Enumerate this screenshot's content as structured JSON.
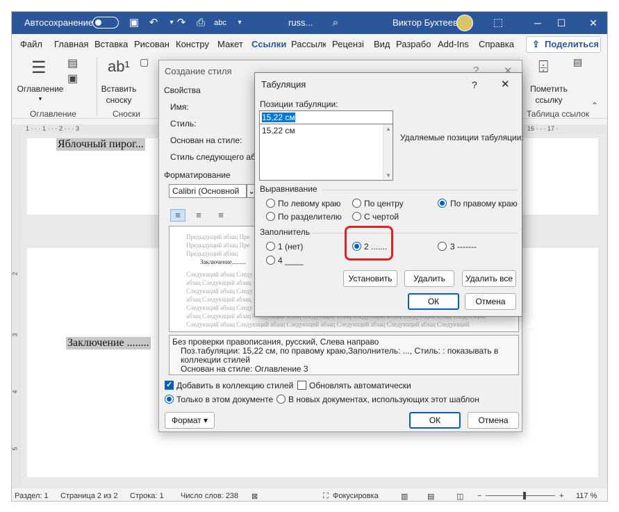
{
  "titlebar": {
    "autosave": "Автосохранение",
    "doc_name": "russ...",
    "user_name": "Виктор Бухтеев"
  },
  "menu": {
    "tabs": [
      "Файл",
      "Главная",
      "Вставка",
      "Рисован",
      "Констру",
      "Макет",
      "Ссылки",
      "Рассылк",
      "Рецензі",
      "Вид",
      "Разрабо",
      "Add-Ins",
      "Справка"
    ],
    "active_tab": "Ссылки",
    "share": "Поделиться"
  },
  "ribbon": {
    "toc_label": "Оглавление",
    "toc_group": "Оглавление",
    "footnote_label_1": "Вставить",
    "footnote_label_2": "сноску",
    "footnote_group": "Сноски",
    "mark_label_1": "Пометить",
    "mark_label_2": "ссылку",
    "tables_group": "Таблица ссылок"
  },
  "ruler": {
    "left": "1 · · · 1 · · · 2 · · · 3",
    "right": "16 · · · 17 ·",
    "v2": "2",
    "v3": "3",
    "v4": "4",
    "v5": "5"
  },
  "document": {
    "line1": "Яблочный пирог...",
    "line2": "Заключение ........"
  },
  "statusbar": {
    "section": "Раздел: 1",
    "page": "Страница 2 из 2",
    "line": "Строка: 1",
    "words": "Число слов: 238",
    "focus": "Фокусировка",
    "zoom": "117 %"
  },
  "style_dialog": {
    "title": "Создание стиля",
    "properties": "Свойства",
    "name_label": "Имя:",
    "style_label": "Стиль:",
    "based_on_label": "Основан на стиле:",
    "next_style_label": "Стиль следующего абза",
    "formatting": "Форматирование",
    "font": "Calibri (Основной",
    "preview": {
      "prev1": "Предыдущий абзац Пре",
      "prev2": "Предыдущий абзац Пре",
      "prev3": "Предыдущий абзац",
      "sample": "Заключение.........",
      "next_lines": [
        "Следующий абзац Следу",
        "абзац Следующий абзац",
        "Следующий абзац Следу",
        "абзац Следующий абзац",
        "Следующий абзац Следу",
        "абзац Следующий абзац Следующий абзац Следующий абзац Следующий абзац Следующий абзац Следующий",
        "Следующий абзац Следующий абзац Следующий абзац Следующий абзац Следующий абзац Следующий"
      ]
    },
    "description": {
      "line1": "Без проверки правописания, русский, Слева направо",
      "line2": "Поз.табуляции:  15,22 см, по правому краю,Заполнитель: ..., Стиль: : показывать в",
      "line3": "коллекции стилей",
      "line4": "Основан на стиле: Оглавление 3"
    },
    "add_to_gallery": "Добавить в коллекцию стилей",
    "auto_update": "Обновлять автоматически",
    "only_this_doc": "Только в этом документе",
    "new_docs": "В новых документах, использующих этот шаблон",
    "format_btn": "Формат",
    "ok": "ОК",
    "cancel": "Отмена"
  },
  "tab_dialog": {
    "title": "Табуляция",
    "positions_label": "Позиции табуляции:",
    "position_value": "15,22 см",
    "list_item": "15,22 см",
    "remove_label": "Удаляемые позиции табуляции:",
    "alignment_label": "Выравнивание",
    "align_left": "По левому краю",
    "align_center": "По центру",
    "align_right": "По правому краю",
    "align_decimal": "По разделителю",
    "align_bar": "С чертой",
    "leader_label": "Заполнитель",
    "leader_1": "1 (нет)",
    "leader_2": "2 .......",
    "leader_3": "3 -------",
    "leader_4": "4 ____",
    "set_btn": "Установить",
    "clear_btn": "Удалить",
    "clear_all_btn": "Удалить все",
    "ok": "ОК",
    "cancel": "Отмена"
  },
  "colors": {
    "accent": "#2b579a",
    "selection": "#005fb8",
    "highlight": "#e32020"
  }
}
